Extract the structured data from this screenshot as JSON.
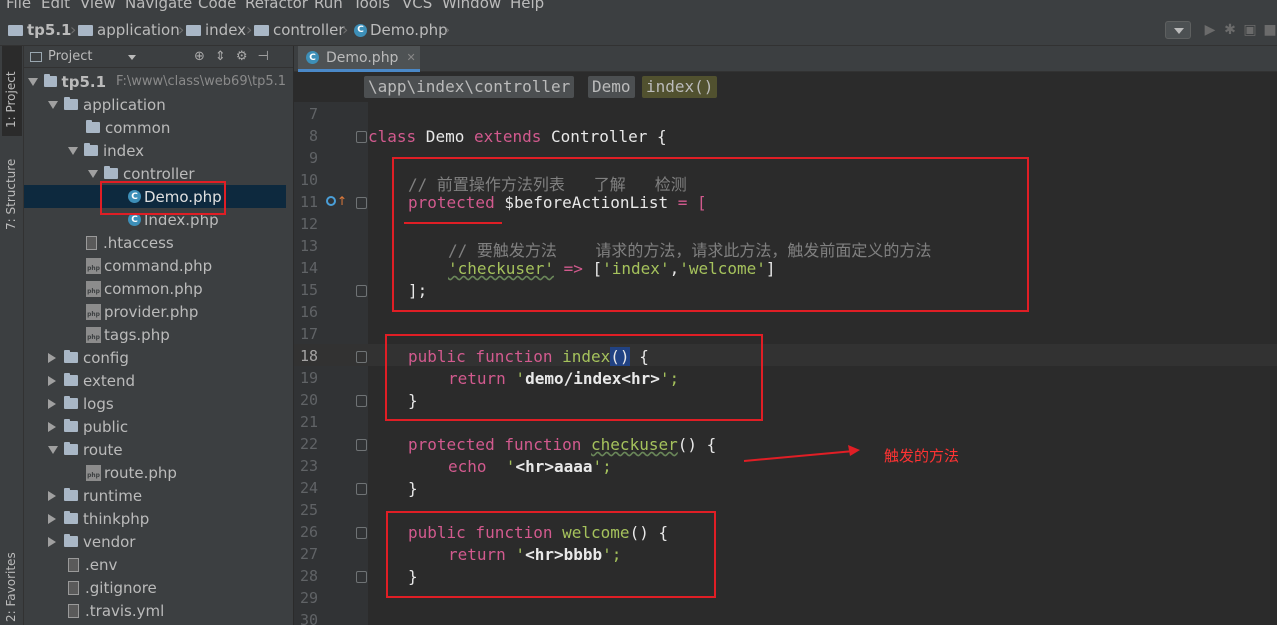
{
  "menu": [
    "File",
    "Edit",
    "View",
    "Navigate",
    "Code",
    "Refactor",
    "Run",
    "Tools",
    "VCS",
    "Window",
    "Help"
  ],
  "navbar": {
    "crumbs": [
      "tp5.1",
      "application",
      "index",
      "controller",
      "Demo.php"
    ]
  },
  "toolstrip": {
    "project_tab": "1: Project",
    "structure_tab": "7: Structure",
    "favorites_tab": "2: Favorites"
  },
  "project": {
    "header": "Project",
    "root": "tp5.1",
    "root_path": "F:\\www\\class\\web69\\tp5.1",
    "items": [
      "application",
      "common",
      "index",
      "controller",
      "Demo.php",
      "Index.php",
      ".htaccess",
      "command.php",
      "common.php",
      "provider.php",
      "tags.php",
      "config",
      "extend",
      "logs",
      "public",
      "route",
      "route.php",
      "runtime",
      "thinkphp",
      "vendor",
      ".env",
      ".gitignore",
      ".travis.yml"
    ]
  },
  "editor": {
    "tab": "Demo.php",
    "breadcrumbs": [
      "\\app\\index\\controller",
      "Demo",
      "index()"
    ],
    "line_numbers": [
      "7",
      "8",
      "9",
      "10",
      "11",
      "12",
      "13",
      "14",
      "15",
      "16",
      "17",
      "18",
      "19",
      "20",
      "21",
      "22",
      "23",
      "24",
      "25",
      "26",
      "27",
      "28",
      "29",
      "30"
    ],
    "code": {
      "l8": [
        "class",
        " Demo ",
        "extends",
        " Controller {"
      ],
      "l10": "// 前置操作方法列表   了解   检测",
      "l11": [
        "protected",
        " $beforeActionList",
        " = ["
      ],
      "l13": "// 要触发方法    请求的方法，请求此方法，触发前面定义的方法",
      "l14": [
        "'checkuser'",
        " => ",
        "[",
        "'index'",
        ",",
        "'welcome'",
        "]"
      ],
      "l15": "];",
      "l18": [
        "public",
        " function ",
        "index",
        "()",
        " {"
      ],
      "l19": [
        "return",
        " '",
        "demo/index<hr>",
        "';"
      ],
      "l20": "}",
      "l22": [
        "protected",
        " function ",
        "checkuser",
        "() {"
      ],
      "l23": [
        "echo",
        "  '",
        "<hr>aaaa",
        "';"
      ],
      "l24": "}",
      "l26": [
        "public",
        " function ",
        "welcome",
        "() {"
      ],
      "l27": [
        "return",
        " '",
        "<hr>bbbb",
        "';"
      ],
      "l28": "}"
    }
  },
  "annotation": "触发的方法"
}
